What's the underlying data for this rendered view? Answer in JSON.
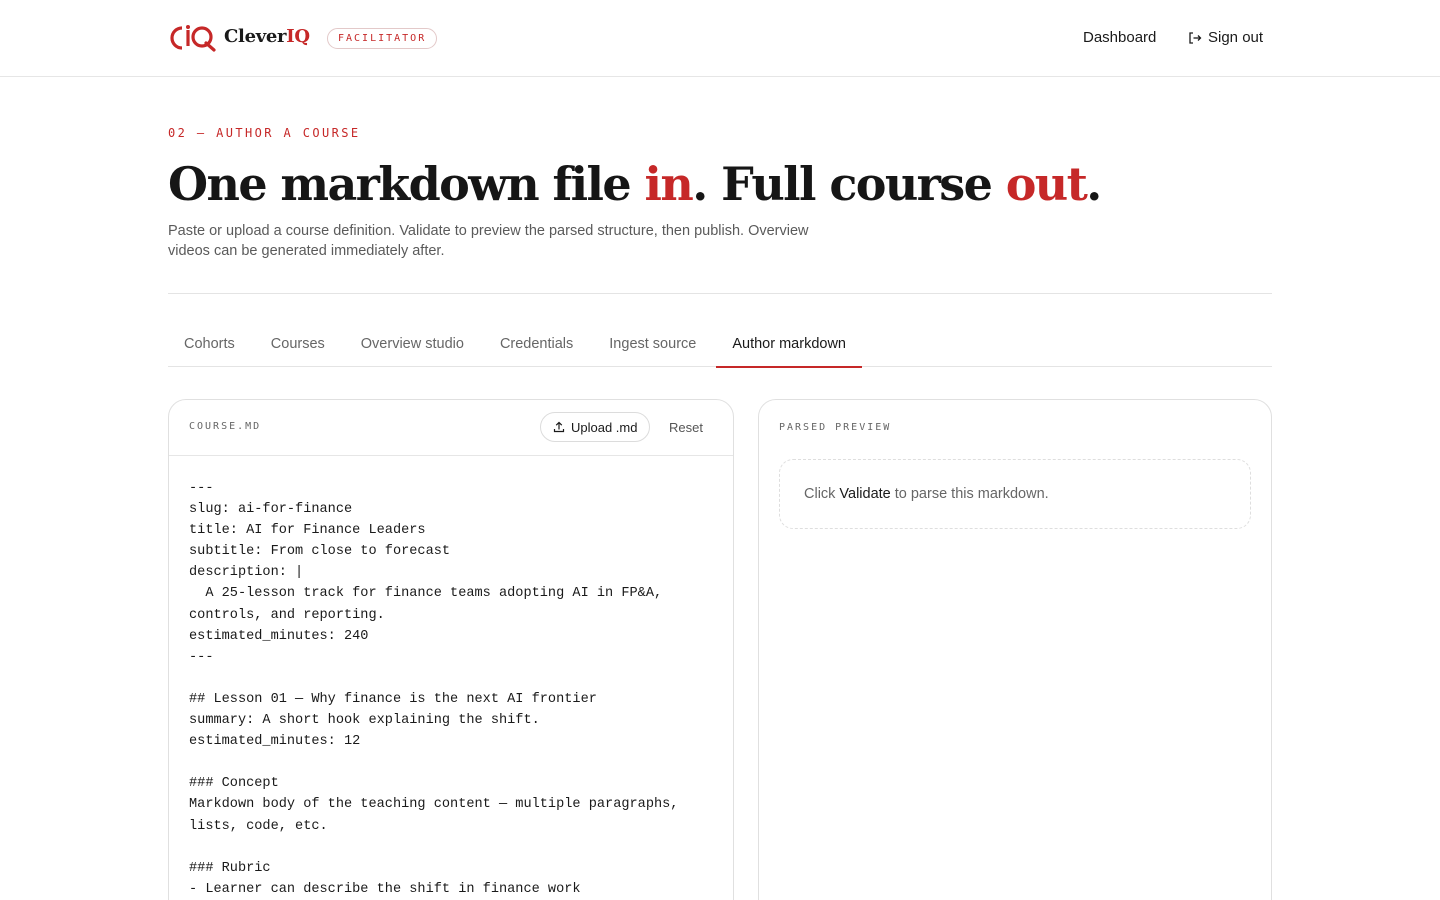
{
  "header": {
    "logo_name_main": "Clever",
    "logo_name_accent": "IQ",
    "role_badge": "FACILITATOR",
    "nav_dashboard": "Dashboard",
    "nav_signout": "Sign out"
  },
  "hero": {
    "eyebrow": "02 — AUTHOR A COURSE",
    "title_part1": "One markdown file ",
    "title_red1": "in",
    "title_part2": ". Full course ",
    "title_red2": "out",
    "title_part3": ".",
    "subtitle": "Paste or upload a course definition. Validate to preview the parsed structure, then publish. Overview videos can be generated immediately after."
  },
  "tabs": [
    {
      "label": "Cohorts",
      "active": false
    },
    {
      "label": "Courses",
      "active": false
    },
    {
      "label": "Overview studio",
      "active": false
    },
    {
      "label": "Credentials",
      "active": false
    },
    {
      "label": "Ingest source",
      "active": false
    },
    {
      "label": "Author markdown",
      "active": true
    }
  ],
  "editor": {
    "file_label": "COURSE.MD",
    "upload_label": "Upload .md",
    "reset_label": "Reset",
    "content": "---\nslug: ai-for-finance\ntitle: AI for Finance Leaders\nsubtitle: From close to forecast\ndescription: |\n  A 25-lesson track for finance teams adopting AI in FP&A,\ncontrols, and reporting.\nestimated_minutes: 240\n---\n\n## Lesson 01 — Why finance is the next AI frontier\nsummary: A short hook explaining the shift.\nestimated_minutes: 12\n\n### Concept\nMarkdown body of the teaching content — multiple paragraphs,\nlists, code, etc.\n\n### Rubric\n- Learner can describe the shift in finance work"
  },
  "preview": {
    "label": "PARSED PREVIEW",
    "empty_prefix": "Click",
    "empty_action": "Validate",
    "empty_suffix": "to parse this markdown."
  },
  "colors": {
    "accent": "#c62828",
    "text": "#1a1a1a",
    "muted": "#666666",
    "border": "#e4e4e4"
  }
}
